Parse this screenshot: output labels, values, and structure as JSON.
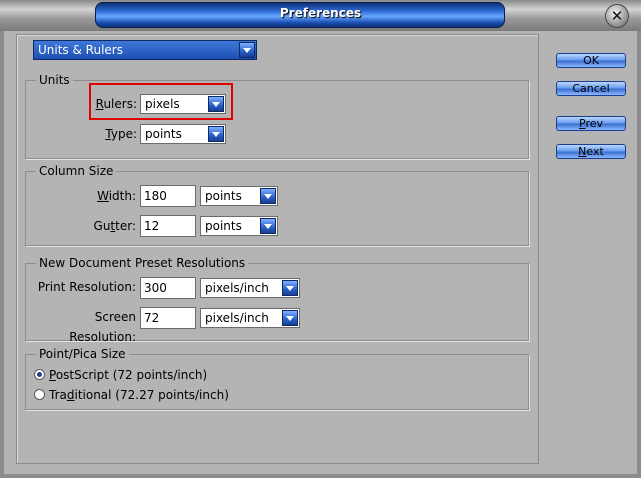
{
  "window": {
    "title": "Preferences",
    "close_symbol": "✕"
  },
  "panel_select": {
    "value": "Units & Rulers"
  },
  "units": {
    "legend": "Units",
    "rulers": {
      "label_u": "R",
      "label_rest": "ulers:",
      "value": "pixels"
    },
    "type": {
      "label_u": "T",
      "label_rest": "ype:",
      "value": "points"
    }
  },
  "column_size": {
    "legend": "Column Size",
    "width": {
      "label_u": "W",
      "label_rest": "idth:",
      "value": "180",
      "unit": "points"
    },
    "gutter": {
      "label_pre": "Gu",
      "label_u": "t",
      "label_rest": "ter:",
      "value": "12",
      "unit": "points"
    }
  },
  "preset_resolutions": {
    "legend": "New Document Preset Resolutions",
    "print": {
      "label": "Print Resolution:",
      "value": "300",
      "unit": "pixels/inch"
    },
    "screen": {
      "label": "Screen Resolution:",
      "value": "72",
      "unit": "pixels/inch"
    }
  },
  "point_pica": {
    "legend": "Point/Pica Size",
    "options": [
      {
        "u": "P",
        "rest": "ostScript (72 points/inch)",
        "selected": true
      },
      {
        "pre": "Tra",
        "u": "d",
        "rest": "itional (72.27 points/inch)",
        "selected": false
      }
    ]
  },
  "buttons": {
    "ok": "OK",
    "cancel": "Cancel",
    "prev_u": "P",
    "prev_rest": "rev",
    "next_u": "N",
    "next_rest": "ext"
  },
  "colors": {
    "accent": "#2a5fc8",
    "highlight": "#e00000",
    "dialog_bg": "#b4b4b4"
  }
}
